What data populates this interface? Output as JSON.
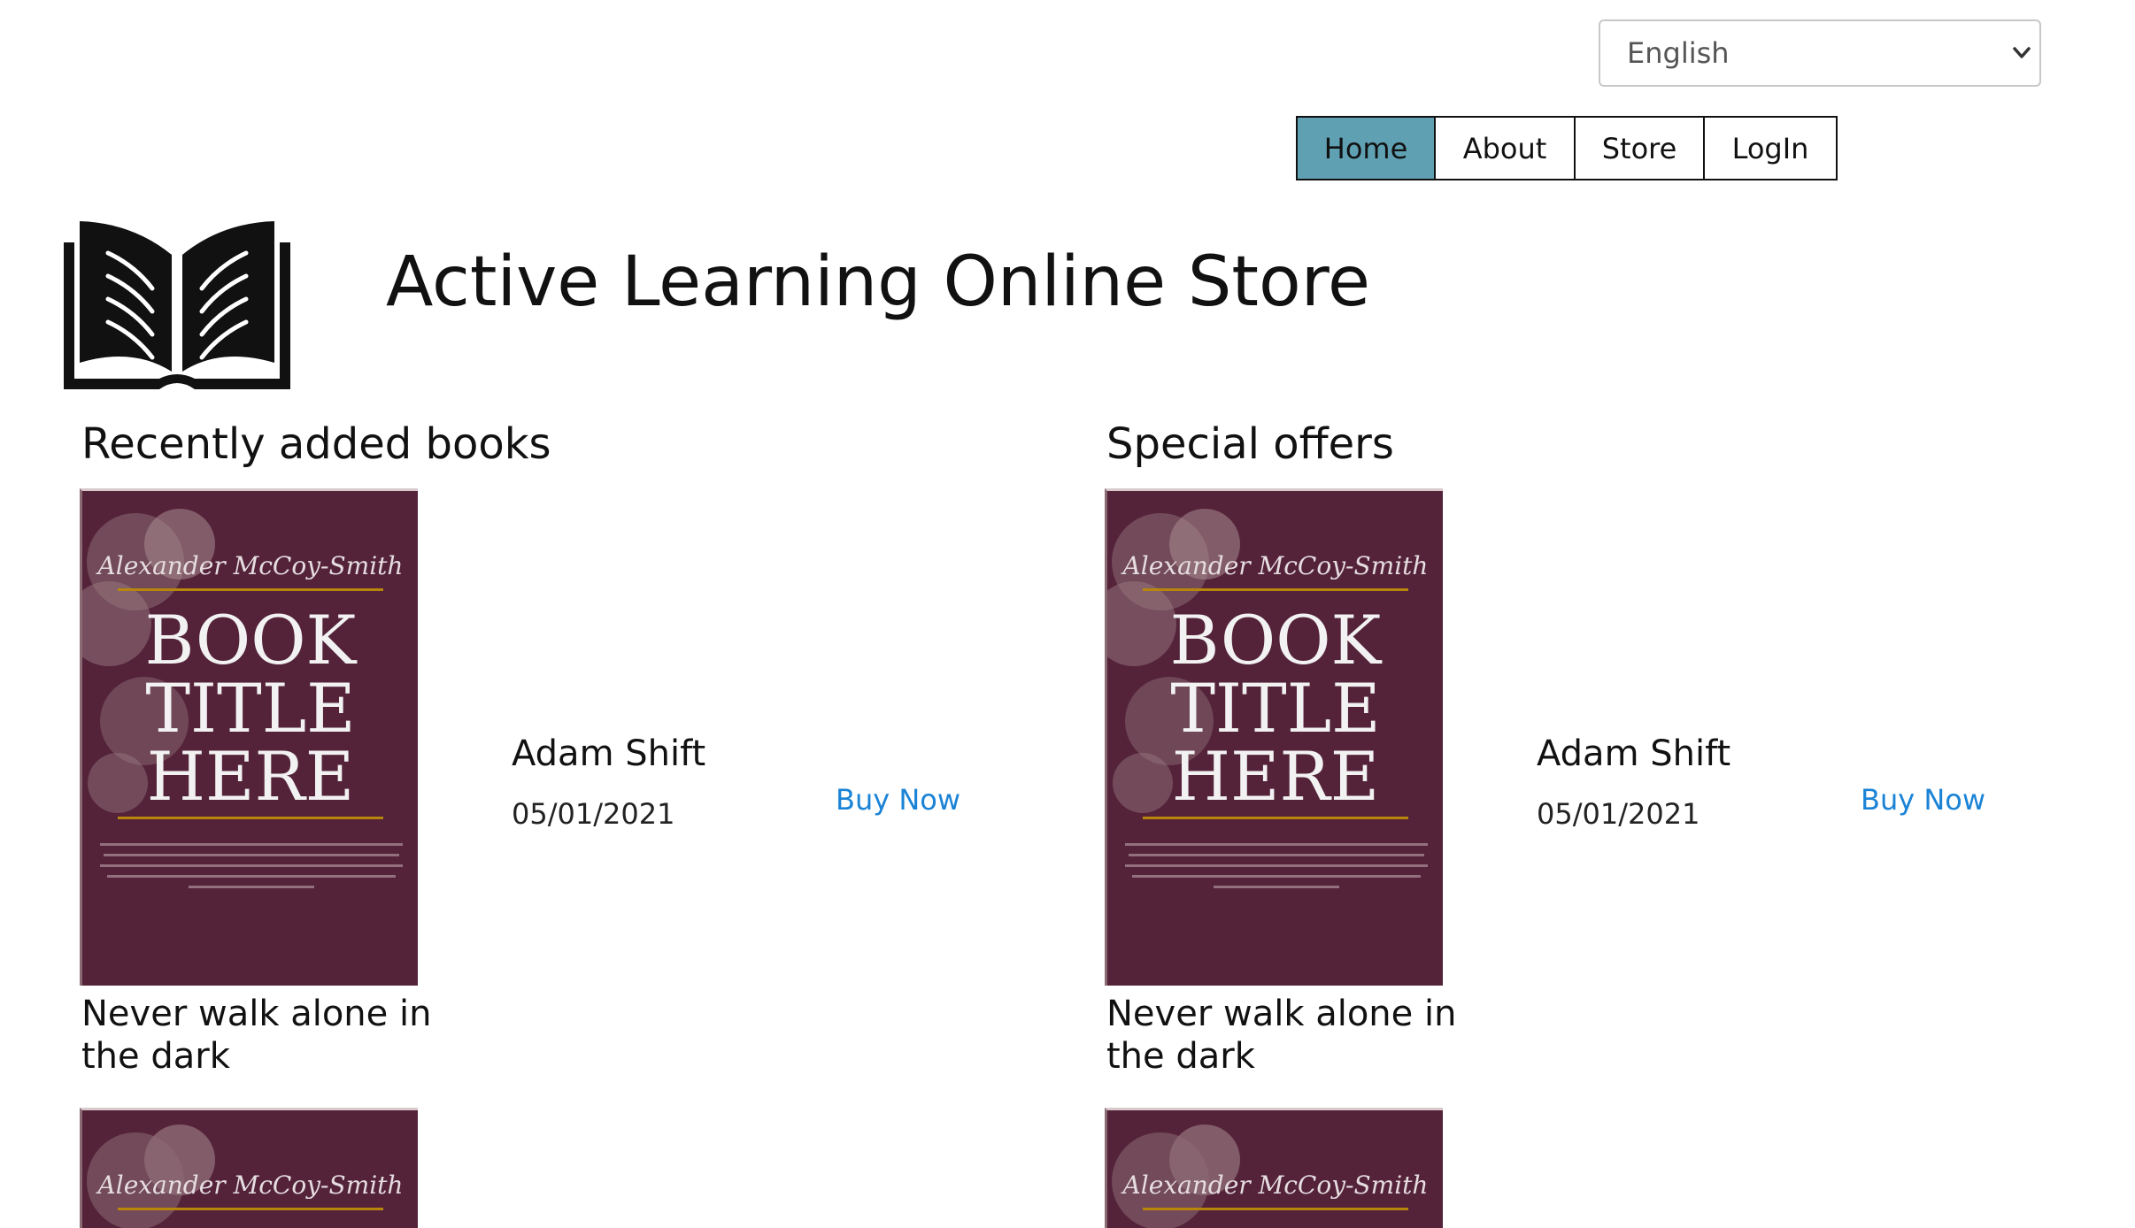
{
  "language_select": {
    "selected": "English",
    "options": [
      "English"
    ]
  },
  "nav": {
    "items": [
      {
        "label": "Home",
        "active": true
      },
      {
        "label": "About",
        "active": false
      },
      {
        "label": "Store",
        "active": false
      },
      {
        "label": "LogIn",
        "active": false
      }
    ]
  },
  "header": {
    "title": "Active Learning Online Store",
    "logo_icon": "open-book-icon"
  },
  "sections": [
    {
      "title": "Recently added books",
      "books": [
        {
          "cover": {
            "author_script": "Alexander McCoy-Smith",
            "line1": "BOOK",
            "line2": "TITLE",
            "line3": "HERE"
          },
          "title": "Never walk alone in the dark",
          "author": "Adam Shift",
          "date": "05/01/2021",
          "action": "Buy Now"
        },
        {
          "cover": {
            "author_script": "Alexander McCoy-Smith"
          }
        }
      ]
    },
    {
      "title": "Special offers",
      "books": [
        {
          "cover": {
            "author_script": "Alexander McCoy-Smith",
            "line1": "BOOK",
            "line2": "TITLE",
            "line3": "HERE"
          },
          "title": "Never walk alone in the dark",
          "author": "Adam Shift",
          "date": "05/01/2021",
          "action": "Buy Now"
        },
        {
          "cover": {
            "author_script": "Alexander McCoy-Smith"
          }
        }
      ]
    }
  ],
  "colors": {
    "nav_active": "#5fa1b3",
    "link": "#1a83d6",
    "cover_background": "#54233a",
    "cover_accent": "#b8860b"
  }
}
